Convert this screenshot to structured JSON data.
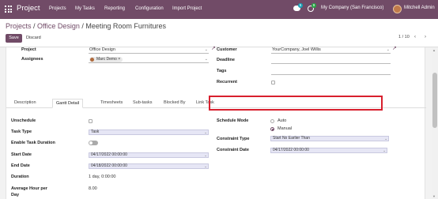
{
  "topbar": {
    "app_title": "Project",
    "nav": [
      "Projects",
      "My Tasks",
      "Reporting",
      "Configuration",
      "Import Project"
    ],
    "chat_count": "5",
    "activity_count": "9",
    "company": "My Company (San Francisco)",
    "user": "Mitchell Admin"
  },
  "control": {
    "crumb_projects": "Projects",
    "crumb_sep1": " / ",
    "crumb_project": "Office Design",
    "crumb_sep2": " / ",
    "crumb_task": "Meeting Room Furnitures",
    "save_label": "Save",
    "discard_label": "Discard",
    "pager": "1 / 10",
    "prev": "‹",
    "next": "›"
  },
  "form": {
    "project_label": "Project",
    "project_value": "Office Design",
    "assignees_label": "Assignees",
    "assignee_tag": "Marc Demo",
    "customer_label": "Customer",
    "customer_value": "YourCompany, Joel Willis",
    "deadline_label": "Deadline",
    "tags_label": "Tags",
    "recurrent_label": "Recurrent"
  },
  "tabs": [
    "Description",
    "Gantt Detail",
    "Timesheets",
    "Sub-tasks",
    "Blocked By",
    "Link Task"
  ],
  "gantt": {
    "unschedule_label": "Unschedule",
    "task_type_label": "Task Type",
    "task_type_value": "Task",
    "enable_duration_label": "Enable Task Duration",
    "start_date_label": "Start Date",
    "start_date_value": "04/17/2022 00:00:00",
    "end_date_label": "End Date",
    "end_date_value": "04/18/2022 00:00:00",
    "duration_label": "Duration",
    "duration_value": "1 day, 0:00:00",
    "avg_hour_label_1": "Average Hour per",
    "avg_hour_label_2": "Day",
    "avg_hour_value": "8.00",
    "schedule_mode_label": "Schedule Mode",
    "mode_auto": "Auto",
    "mode_manual": "Manual",
    "constraint_type_label": "Constraint Type",
    "constraint_type_value": "Start No Earlier Than",
    "constraint_date_label": "Constraint Date",
    "constraint_date_value": "04/17/2022 00:00:00"
  },
  "colors": {
    "brand": "#714b67",
    "highlight": "#d8202e"
  }
}
